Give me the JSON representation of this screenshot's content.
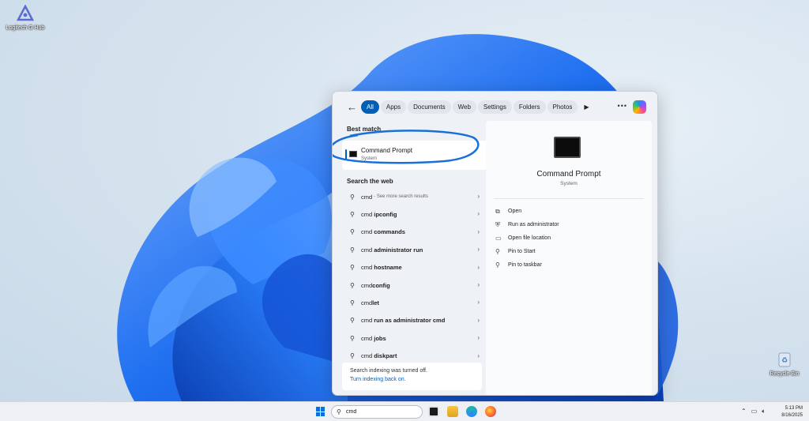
{
  "desktop": {
    "icons": [
      {
        "label": "Logitech G Hub",
        "icon": "app-shortcut-icon"
      },
      {
        "label": "Recycle Bin",
        "icon": "recycle-bin-icon"
      }
    ]
  },
  "search_panel": {
    "filters": [
      "All",
      "Apps",
      "Documents",
      "Web",
      "Settings",
      "Folders",
      "Photos"
    ],
    "active_filter": "All",
    "more_label": "•••",
    "best_match": {
      "header": "Best match",
      "title": "Command Prompt",
      "subtitle": "System"
    },
    "web_header": "Search the web",
    "web_results": [
      {
        "prefix": "cmd",
        "bold": "",
        "hint": " - See more search results"
      },
      {
        "prefix": "cmd ",
        "bold": "ipconfig",
        "hint": ""
      },
      {
        "prefix": "cmd ",
        "bold": "commands",
        "hint": ""
      },
      {
        "prefix": "cmd ",
        "bold": "administrator run",
        "hint": ""
      },
      {
        "prefix": "cmd ",
        "bold": "hostname",
        "hint": ""
      },
      {
        "prefix": "cmd",
        "bold": "config",
        "hint": ""
      },
      {
        "prefix": "cmd",
        "bold": "let",
        "hint": ""
      },
      {
        "prefix": "cmd ",
        "bold": "run as administrator cmd",
        "hint": ""
      },
      {
        "prefix": "cmd ",
        "bold": "jobs",
        "hint": ""
      },
      {
        "prefix": "cmd ",
        "bold": "diskpart",
        "hint": ""
      }
    ],
    "indexing": {
      "message": "Search indexing was turned off.",
      "link": "Turn indexing back on."
    },
    "preview": {
      "title": "Command Prompt",
      "subtitle": "System",
      "actions": [
        {
          "label": "Open",
          "icon": "open-external-icon"
        },
        {
          "label": "Run as administrator",
          "icon": "shield-admin-icon"
        },
        {
          "label": "Open file location",
          "icon": "folder-icon"
        },
        {
          "label": "Pin to Start",
          "icon": "pin-icon"
        },
        {
          "label": "Pin to taskbar",
          "icon": "pin-icon"
        }
      ]
    }
  },
  "taskbar": {
    "search_value": "cmd",
    "clock_time": "5:13 PM",
    "clock_date": "8/16/2025",
    "apps": [
      "terminal-icon",
      "file-explorer-icon",
      "edge-icon",
      "firefox-icon"
    ]
  },
  "colors": {
    "accent": "#005fb8",
    "annotation_ring": "#1a6fd9",
    "wallpaper_bloom": "#1f6ff0"
  }
}
